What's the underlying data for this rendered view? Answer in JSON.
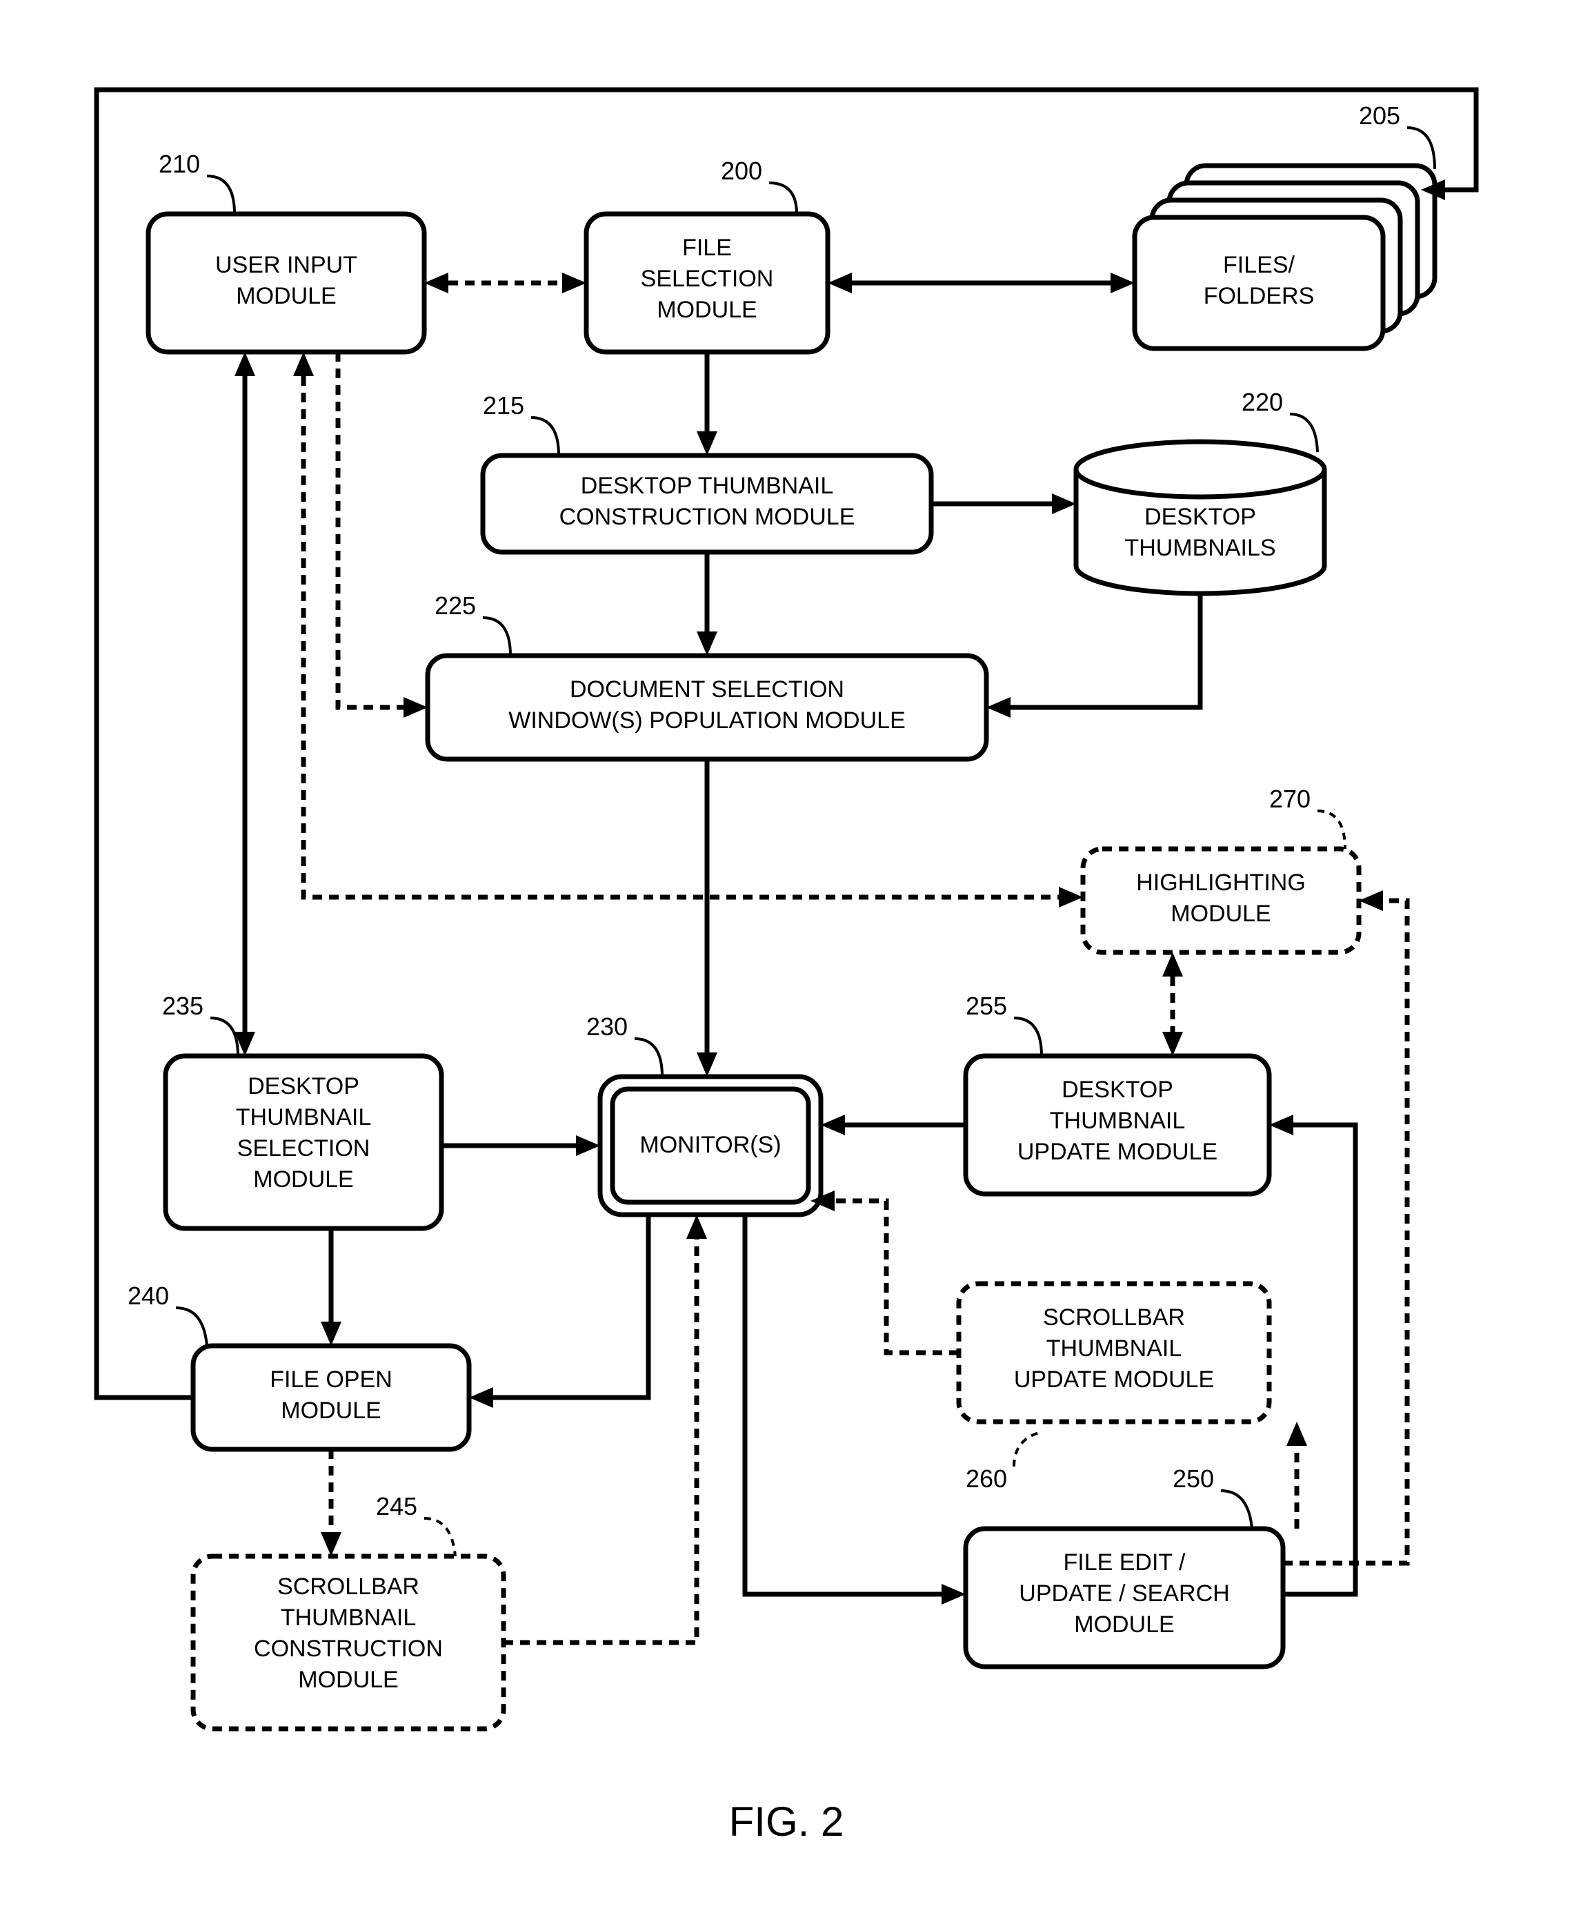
{
  "figure_label": "FIG. 2",
  "nodes": {
    "n200": {
      "ref": "200",
      "lines": [
        "FILE",
        "SELECTION",
        "MODULE"
      ]
    },
    "n205": {
      "ref": "205",
      "lines": [
        "FILES/",
        "FOLDERS"
      ]
    },
    "n210": {
      "ref": "210",
      "lines": [
        "USER INPUT",
        "MODULE"
      ]
    },
    "n215": {
      "ref": "215",
      "lines": [
        "DESKTOP THUMBNAIL",
        "CONSTRUCTION MODULE"
      ]
    },
    "n220": {
      "ref": "220",
      "lines": [
        "DESKTOP",
        "THUMBNAILS"
      ]
    },
    "n225": {
      "ref": "225",
      "lines": [
        "DOCUMENT SELECTION",
        "WINDOW(S) POPULATION MODULE"
      ]
    },
    "n230": {
      "ref": "230",
      "lines": [
        "MONITOR(S)"
      ]
    },
    "n235": {
      "ref": "235",
      "lines": [
        "DESKTOP",
        "THUMBNAIL",
        "SELECTION",
        "MODULE"
      ]
    },
    "n240": {
      "ref": "240",
      "lines": [
        "FILE OPEN",
        "MODULE"
      ]
    },
    "n245": {
      "ref": "245",
      "lines": [
        "SCROLLBAR",
        "THUMBNAIL",
        "CONSTRUCTION",
        "MODULE"
      ]
    },
    "n250": {
      "ref": "250",
      "lines": [
        "FILE EDIT /",
        "UPDATE / SEARCH",
        "MODULE"
      ]
    },
    "n255": {
      "ref": "255",
      "lines": [
        "DESKTOP",
        "THUMBNAIL",
        "UPDATE MODULE"
      ]
    },
    "n260": {
      "ref": "260",
      "lines": [
        "SCROLLBAR",
        "THUMBNAIL",
        "UPDATE MODULE"
      ]
    },
    "n270": {
      "ref": "270",
      "lines": [
        "HIGHLIGHTING",
        "MODULE"
      ]
    }
  }
}
